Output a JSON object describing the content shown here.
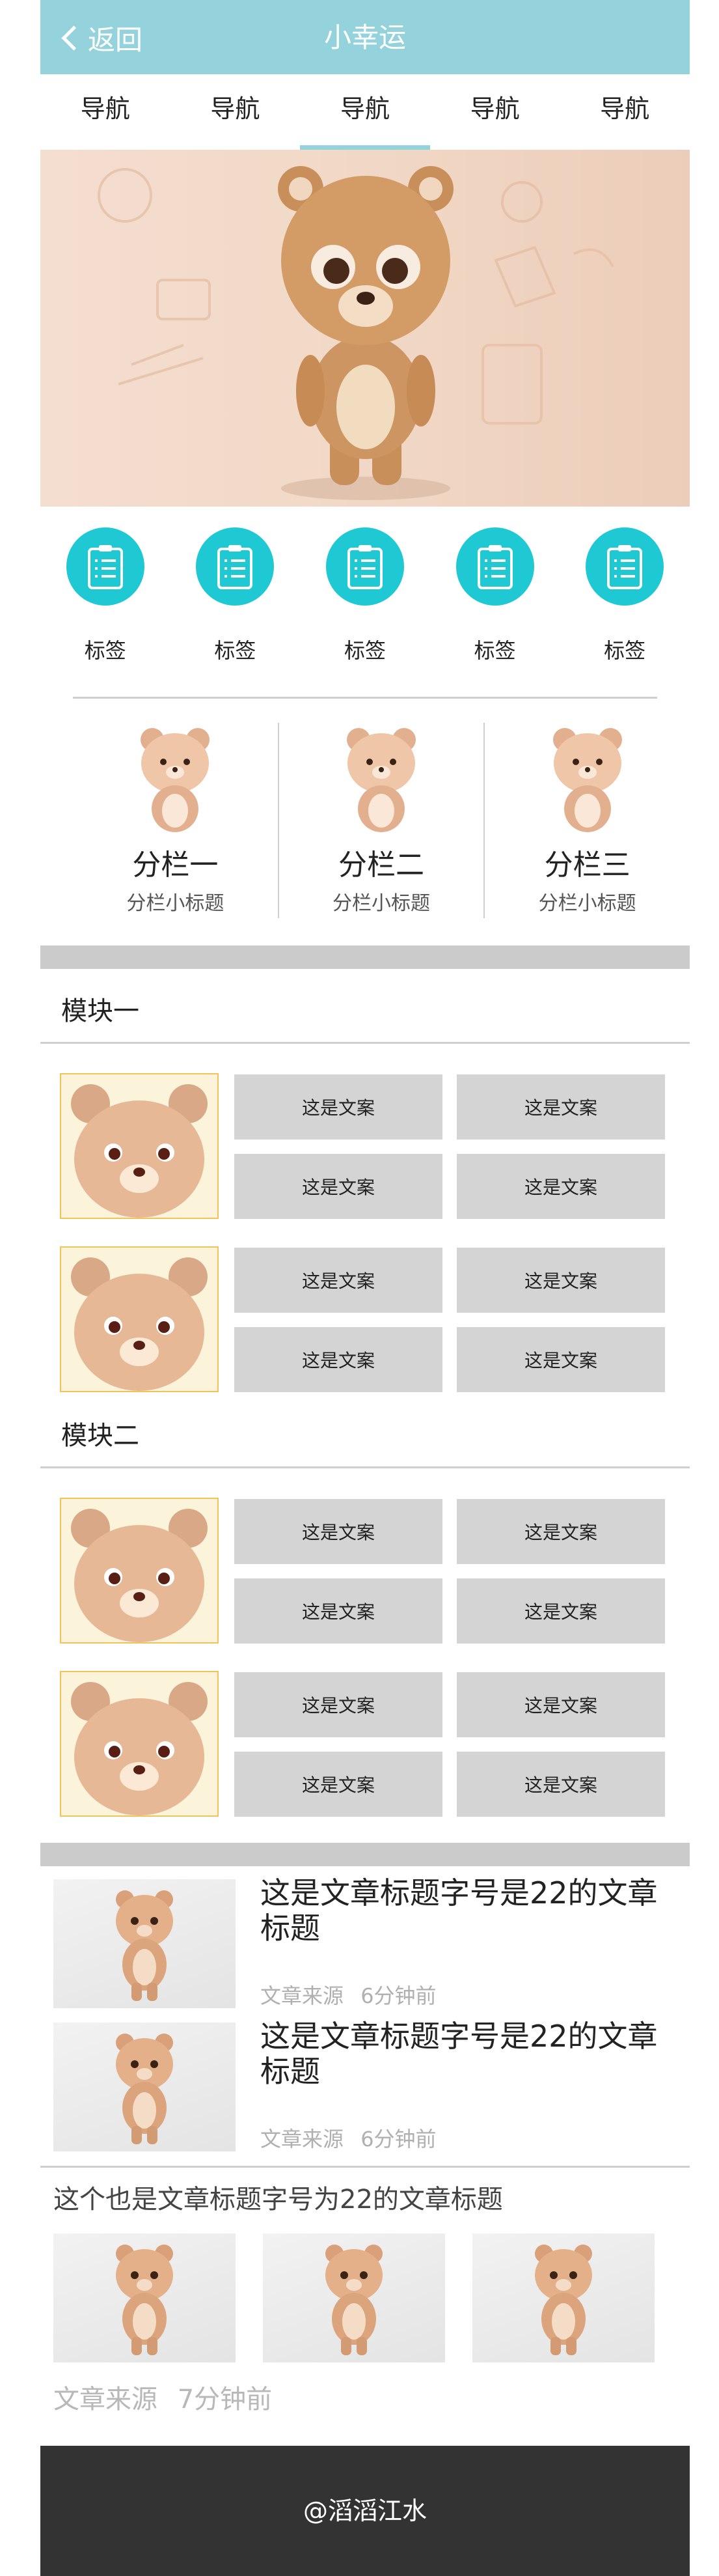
{
  "header": {
    "back_label": "返回",
    "title": "小幸运",
    "bg_color": "#95d3dc"
  },
  "nav": {
    "tabs": [
      "导航",
      "导航",
      "导航",
      "导航",
      "导航"
    ],
    "active_index": 2
  },
  "icon_row": {
    "labels": [
      "标签",
      "标签",
      "标签",
      "标签",
      "标签"
    ],
    "icon": "clipboard-icon",
    "color": "#1ec9d3"
  },
  "columns": [
    {
      "title": "分栏一",
      "subtitle": "分栏小标题"
    },
    {
      "title": "分栏二",
      "subtitle": "分栏小标题"
    },
    {
      "title": "分栏三",
      "subtitle": "分栏小标题"
    }
  ],
  "modules": [
    {
      "title": "模块一",
      "rows": [
        [
          "这是文案",
          "这是文案",
          "这是文案",
          "这是文案"
        ],
        [
          "这是文案",
          "这是文案",
          "这是文案",
          "这是文案"
        ]
      ]
    },
    {
      "title": "模块二",
      "rows": [
        [
          "这是文案",
          "这是文案",
          "这是文案",
          "这是文案"
        ],
        [
          "这是文案",
          "这是文案",
          "这是文案",
          "这是文案"
        ]
      ]
    }
  ],
  "articles": [
    {
      "title": "这是文章标题字号是22的文章标题",
      "source": "文章来源",
      "time": "6分钟前"
    },
    {
      "title": "这是文章标题字号是22的文章标题",
      "source": "文章来源",
      "time": "6分钟前"
    }
  ],
  "gallery_article": {
    "title": "这个也是文章标题字号为22的文章标题",
    "source": "文章来源",
    "time": "7分钟前",
    "image_count": 3
  },
  "footer": {
    "text": "@滔滔江水"
  }
}
